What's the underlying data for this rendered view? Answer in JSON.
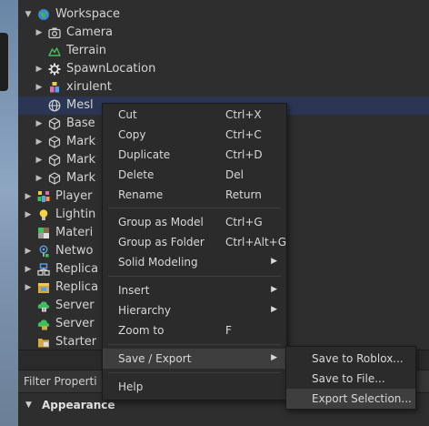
{
  "explorer": {
    "items": [
      {
        "label": "Workspace",
        "icon": "globe-icon"
      },
      {
        "label": "Camera",
        "icon": "camera-icon"
      },
      {
        "label": "Terrain",
        "icon": "terrain-icon"
      },
      {
        "label": "SpawnLocation",
        "icon": "gear-icon"
      },
      {
        "label": "xirulent",
        "icon": "character-icon"
      },
      {
        "label": "Mesl",
        "icon": "globe-icon"
      },
      {
        "label": "Base",
        "icon": "part-icon"
      },
      {
        "label": "Mark",
        "icon": "part-icon"
      },
      {
        "label": "Mark",
        "icon": "part-icon"
      },
      {
        "label": "Mark",
        "icon": "part-icon"
      },
      {
        "label": "Player",
        "icon": "players-icon"
      },
      {
        "label": "Lightin",
        "icon": "lightbulb-icon"
      },
      {
        "label": "Materi",
        "icon": "material-icon"
      },
      {
        "label": "Netwo",
        "icon": "network-icon"
      },
      {
        "label": "Replica",
        "icon": "replicated-first-icon"
      },
      {
        "label": "Replica",
        "icon": "replicated-storage-icon"
      },
      {
        "label": "Server",
        "icon": "server-script-icon"
      },
      {
        "label": "Server",
        "icon": "server-storage-icon"
      },
      {
        "label": "Starter",
        "icon": "folder-icon"
      }
    ]
  },
  "properties": {
    "filter_label": "Filter Properti",
    "section_label": "Appearance"
  },
  "context_menu": {
    "items": [
      {
        "label": "Cut",
        "shortcut": "Ctrl+X"
      },
      {
        "label": "Copy",
        "shortcut": "Ctrl+C"
      },
      {
        "label": "Duplicate",
        "shortcut": "Ctrl+D"
      },
      {
        "label": "Delete",
        "shortcut": "Del"
      },
      {
        "label": "Rename",
        "shortcut": "Return"
      },
      {
        "label": "Group as Model",
        "shortcut": "Ctrl+G"
      },
      {
        "label": "Group as Folder",
        "shortcut": "Ctrl+Alt+G"
      },
      {
        "label": "Solid Modeling",
        "shortcut": ""
      },
      {
        "label": "Insert",
        "shortcut": ""
      },
      {
        "label": "Hierarchy",
        "shortcut": ""
      },
      {
        "label": "Zoom to",
        "shortcut": "F"
      },
      {
        "label": "Save / Export",
        "shortcut": ""
      },
      {
        "label": "Help",
        "shortcut": ""
      }
    ],
    "submenu_arrow": "▶"
  },
  "export_submenu": {
    "items": [
      {
        "label": "Save to Roblox..."
      },
      {
        "label": "Save to File..."
      },
      {
        "label": "Export Selection..."
      }
    ]
  },
  "colors": {
    "selected_row": "#2b3655",
    "menu_bg": "#2b2b2b",
    "menu_hover": "#3e3e3e"
  }
}
